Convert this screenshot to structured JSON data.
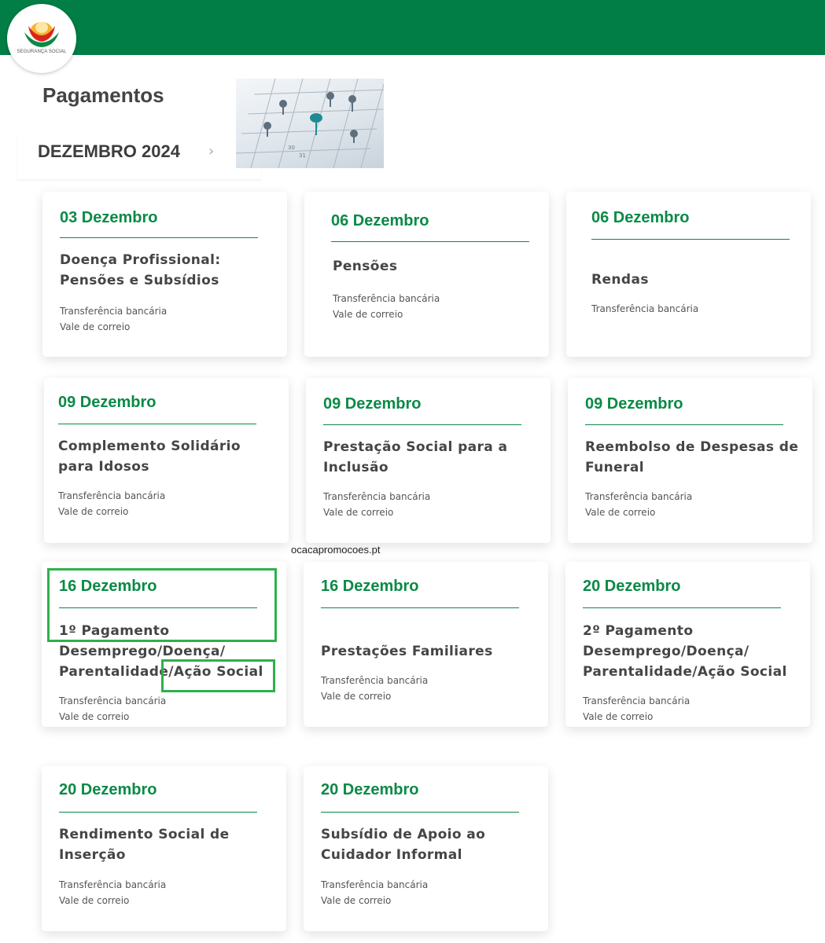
{
  "brand": {
    "logo_text": "SEGURANÇA SOCIAL",
    "primary_color": "#007e45",
    "accent_color": "#0a8a46"
  },
  "header": {
    "title": "Pagamentos"
  },
  "month_nav": {
    "label": "DEZEMBRO 2024",
    "next_icon": "chevron-right-icon"
  },
  "watermark": "ocacapromocoes.pt",
  "cards": [
    {
      "date": "03 Dezembro",
      "title": "Doença Profissional: Pensões e Subsídios",
      "methods": [
        "Transferência bancária",
        "Vale de correio"
      ]
    },
    {
      "date": "06 Dezembro",
      "title": "Pensões",
      "methods": [
        "Transferência bancária",
        "Vale de correio"
      ]
    },
    {
      "date": "06 Dezembro",
      "title": "Rendas",
      "methods": [
        "Transferência bancária"
      ]
    },
    {
      "date": "09 Dezembro",
      "title": "Complemento Solidário para Idosos",
      "methods": [
        "Transferência bancária",
        "Vale de correio"
      ]
    },
    {
      "date": "09 Dezembro",
      "title": "Prestação Social para a Inclusão",
      "methods": [
        "Transferência bancária",
        "Vale de correio"
      ]
    },
    {
      "date": "09 Dezembro",
      "title": "Reembolso de Despesas de Funeral",
      "methods": [
        "Transferência bancária",
        "Vale de correio"
      ]
    },
    {
      "date": "16 Dezembro",
      "title": "1º Pagamento Desemprego/Doença/ Parentalidade/Ação Social",
      "methods": [
        "Transferência bancária",
        "Vale de correio"
      ]
    },
    {
      "date": "16 Dezembro",
      "title": "Prestações Familiares",
      "methods": [
        "Transferência bancária",
        "Vale de correio"
      ]
    },
    {
      "date": "20 Dezembro",
      "title": "2º Pagamento Desemprego/Doença/ Parentalidade/Ação Social",
      "methods": [
        "Transferência bancária",
        "Vale de correio"
      ]
    },
    {
      "date": "20 Dezembro",
      "title": "Rendimento Social de Inserção",
      "methods": [
        "Transferência bancária",
        "Vale de correio"
      ]
    },
    {
      "date": "20 Dezembro",
      "title": "Subsídio de Apoio ao Cuidador Informal",
      "methods": [
        "Transferência bancária",
        "Vale de correio"
      ]
    }
  ]
}
